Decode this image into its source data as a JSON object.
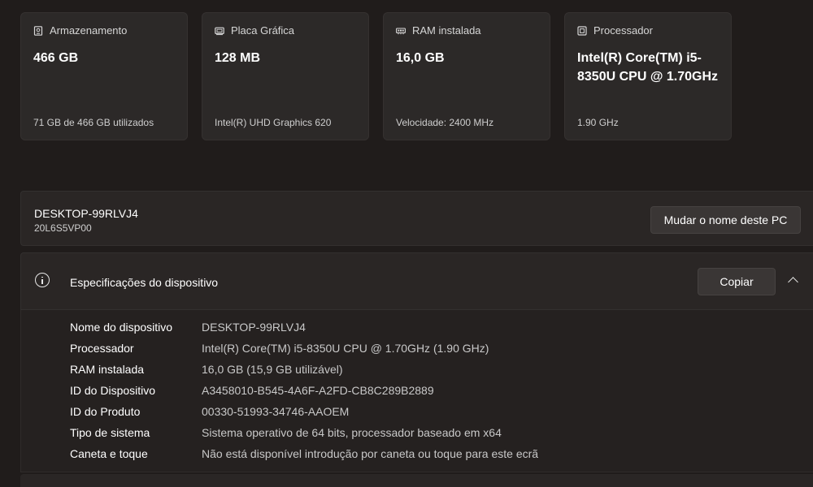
{
  "cards": [
    {
      "title": "Armazenamento",
      "value": "466 GB",
      "sub": "71 GB de 466 GB utilizados",
      "icon": "storage-icon"
    },
    {
      "title": "Placa Gráfica",
      "value": "128 MB",
      "sub": "Intel(R) UHD Graphics 620",
      "icon": "graphics-card-icon"
    },
    {
      "title": "RAM instalada",
      "value": "16,0 GB",
      "sub": "Velocidade: 2400 MHz",
      "icon": "memory-icon"
    },
    {
      "title": "Processador",
      "value": "Intel(R) Core(TM) i5-8350U CPU @ 1.70GHz",
      "sub": "1.90 GHz",
      "icon": "processor-icon"
    }
  ],
  "device_name_panel": {
    "name": "DESKTOP-99RLVJ4",
    "model": "20L6S5VP00",
    "rename_label": "Mudar o nome deste PC"
  },
  "specs": {
    "title": "Especificações do dispositivo",
    "copy_label": "Copiar",
    "rows": [
      {
        "label": "Nome do dispositivo",
        "value": "DESKTOP-99RLVJ4"
      },
      {
        "label": "Processador",
        "value": "Intel(R) Core(TM) i5-8350U CPU @ 1.70GHz (1.90 GHz)"
      },
      {
        "label": "RAM instalada",
        "value": "16,0 GB (15,9 GB utilizável)"
      },
      {
        "label": "ID do Dispositivo",
        "value": "A3458010-B545-4A6F-A2FD-CB8C289B2889"
      },
      {
        "label": "ID do Produto",
        "value": "00330-51993-34746-AAOEM"
      },
      {
        "label": "Tipo de sistema",
        "value": "Sistema operativo de 64 bits, processador baseado em x64"
      },
      {
        "label": "Caneta e toque",
        "value": "Não está disponível introdução por caneta ou toque para este ecrã"
      }
    ]
  }
}
